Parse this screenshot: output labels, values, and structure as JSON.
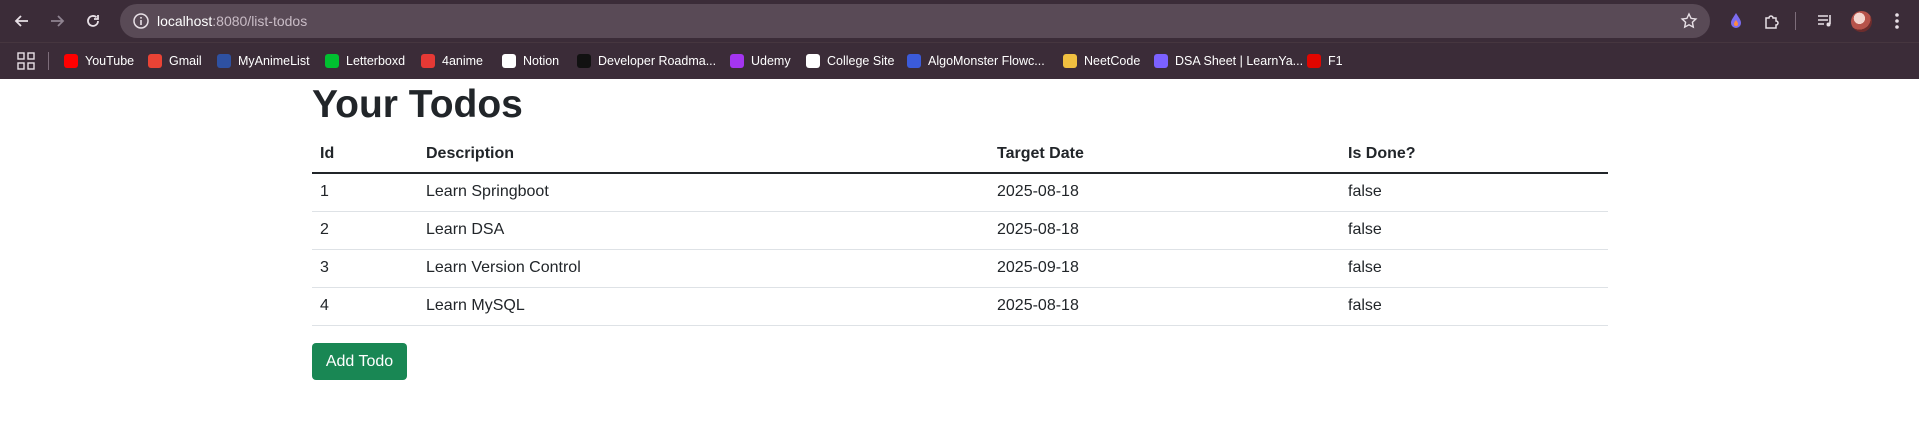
{
  "browser": {
    "url_host": "localhost",
    "url_path": ":8080/list-todos",
    "bookmarks": [
      {
        "label": "YouTube",
        "color": "#ff0000"
      },
      {
        "label": "Gmail",
        "color": "#ea4335"
      },
      {
        "label": "MyAnimeList",
        "color": "#2e51a2"
      },
      {
        "label": "Letterboxd",
        "color": "#00c030"
      },
      {
        "label": "4anime",
        "color": "#e53935"
      },
      {
        "label": "Notion",
        "color": "#ffffff"
      },
      {
        "label": "Developer Roadma...",
        "color": "#111111"
      },
      {
        "label": "Udemy",
        "color": "#a435f0"
      },
      {
        "label": "College Site",
        "color": "#ffffff"
      },
      {
        "label": "AlgoMonster Flowc...",
        "color": "#3b5bdb"
      },
      {
        "label": "NeetCode",
        "color": "#f0c040"
      },
      {
        "label": "DSA Sheet | LearnYa...",
        "color": "#7b61ff"
      },
      {
        "label": "F1",
        "color": "#e10600"
      }
    ]
  },
  "page": {
    "title": "Your Todos",
    "columns": [
      "Id",
      "Description",
      "Target Date",
      "Is Done?"
    ],
    "rows": [
      [
        "1",
        "Learn Springboot",
        "2025-08-18",
        "false"
      ],
      [
        "2",
        "Learn DSA",
        "2025-08-18",
        "false"
      ],
      [
        "3",
        "Learn Version Control",
        "2025-09-18",
        "false"
      ],
      [
        "4",
        "Learn MySQL",
        "2025-08-18",
        "false"
      ]
    ],
    "add_button_label": "Add Todo",
    "button_color": "#198754"
  }
}
